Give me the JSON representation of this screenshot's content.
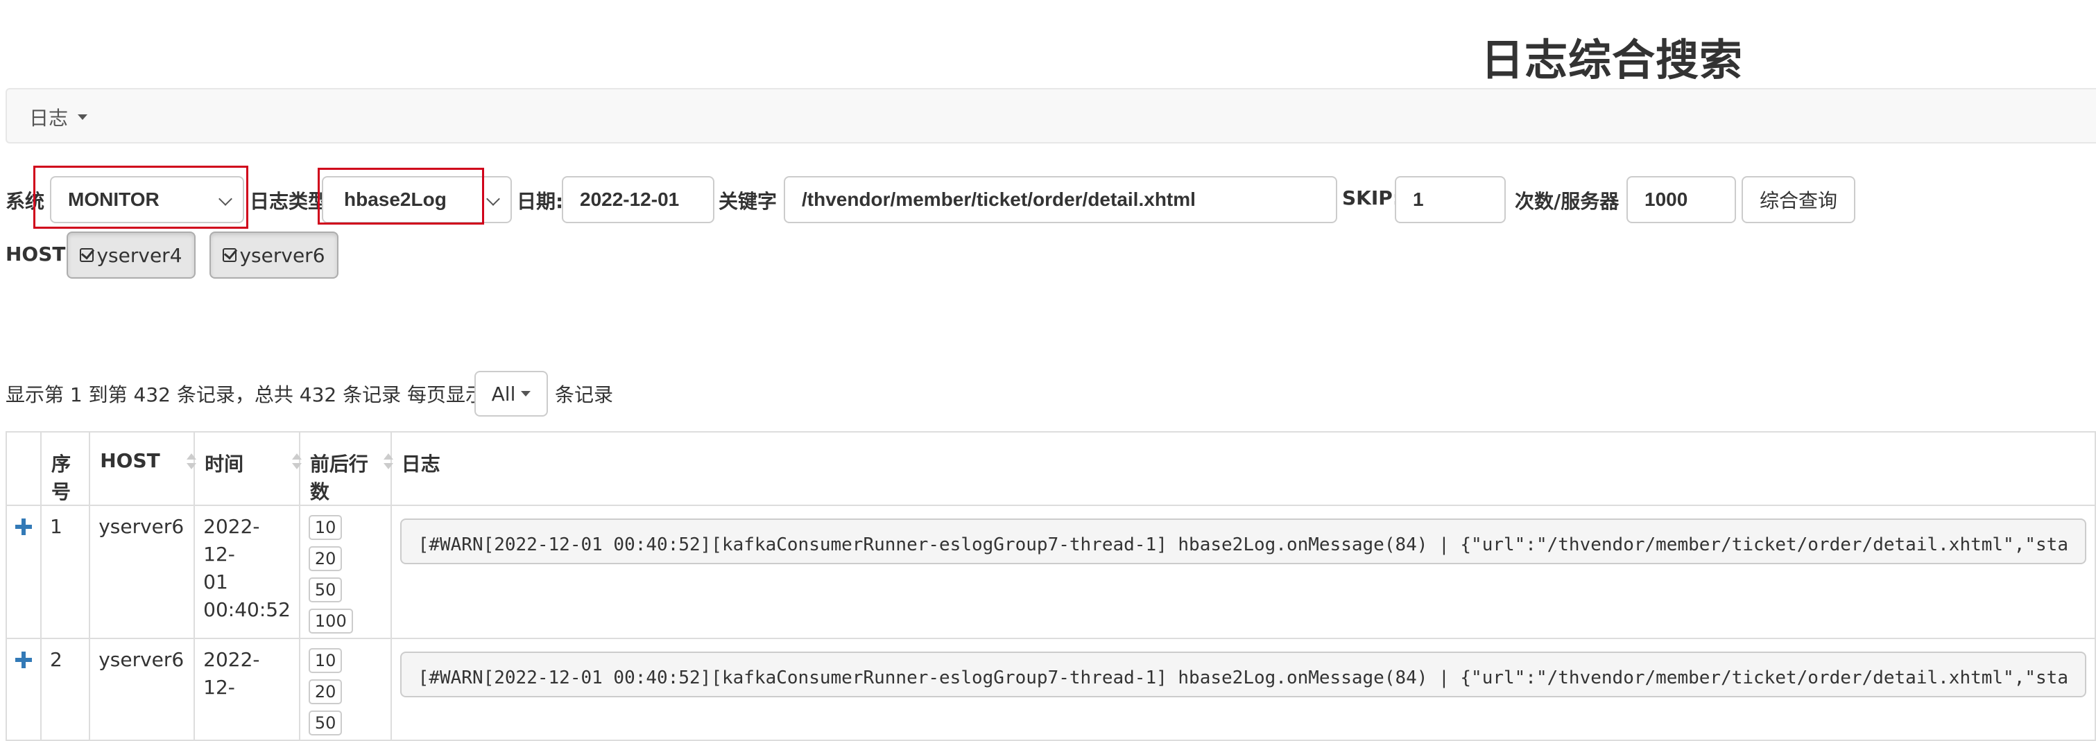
{
  "page_title": "日志综合搜索",
  "navbar": {
    "menu_label": "日志"
  },
  "form": {
    "system_label": "系统",
    "system_value": "MONITOR",
    "logtype_label": "日志类型:",
    "logtype_value": "hbase2Log",
    "date_label": "日期:",
    "date_value": "2022-12-01",
    "keyword_label": "关键字",
    "keyword_value": "/thvendor/member/ticket/order/detail.xhtml",
    "skip_label": "SKIP:",
    "skip_value": "1",
    "count_label": "次数/服务器",
    "count_value": "1000",
    "search_button": "综合查询",
    "host_label": "HOST",
    "hosts": [
      "yserver4",
      "yserver6"
    ]
  },
  "pagination": {
    "summary": "显示第 1 到第 432 条记录，总共 432 条记录 每页显示",
    "page_size": "All",
    "suffix": "条记录"
  },
  "table": {
    "columns": [
      "",
      "序号",
      "HOST",
      "时间",
      "前后行数",
      "日志"
    ],
    "line_options": [
      "10",
      "20",
      "50",
      "100"
    ],
    "rows": [
      {
        "index": "1",
        "host": "yserver6",
        "time_lines": [
          "2022-12-",
          "01",
          "00:40:52"
        ],
        "log": "[#WARN[2022-12-01 00:40:52][kafkaConsumerRunner-eslogGroup7-thread-1] hbase2Log.onMessage(84) | {\"url\":\"/thvendor/member/ticket/order/detail.xhtml\",\"sta"
      },
      {
        "index": "2",
        "host": "yserver6",
        "time_lines": [
          "2022-12-"
        ],
        "log": "[#WARN[2022-12-01 00:40:52][kafkaConsumerRunner-eslogGroup7-thread-1] hbase2Log.onMessage(84) | {\"url\":\"/thvendor/member/ticket/order/detail.xhtml\",\"sta"
      }
    ]
  },
  "colors": {
    "highlight_box": "#d0021b",
    "plus_icon": "#337ab7"
  }
}
